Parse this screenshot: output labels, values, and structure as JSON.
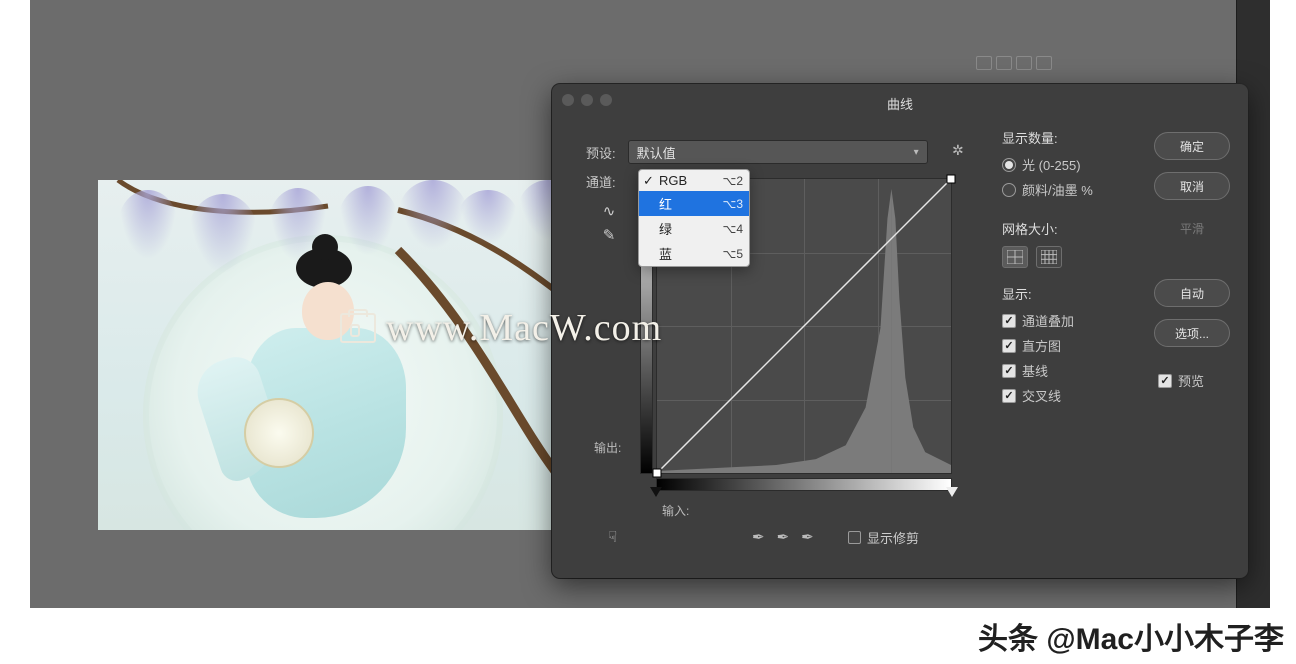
{
  "dialog": {
    "title": "曲线",
    "preset_label": "预设:",
    "preset_value": "默认值",
    "channel_label": "通道:",
    "output_label": "输出:",
    "input_label": "输入:",
    "show_clipping_label": "显示修剪"
  },
  "channel_menu": {
    "items": [
      {
        "label": "RGB",
        "shortcut": "⌥2",
        "checked": true,
        "selected": false
      },
      {
        "label": "红",
        "shortcut": "⌥3",
        "checked": false,
        "selected": true
      },
      {
        "label": "绿",
        "shortcut": "⌥4",
        "checked": false,
        "selected": false
      },
      {
        "label": "蓝",
        "shortcut": "⌥5",
        "checked": false,
        "selected": false
      }
    ]
  },
  "right_panel": {
    "show_amount_title": "显示数量:",
    "light_label": "光 (0-255)",
    "pigment_label": "颜料/油墨 %",
    "grid_title": "网格大小:",
    "show_title": "显示:",
    "overlay_label": "通道叠加",
    "histogram_label": "直方图",
    "baseline_label": "基线",
    "intersection_label": "交叉线"
  },
  "buttons": {
    "ok": "确定",
    "cancel": "取消",
    "smooth": "平滑",
    "auto": "自动",
    "options": "选项...",
    "preview": "预览"
  },
  "watermark": "www.MacW.com",
  "attribution": "头条 @Mac小小木子李"
}
